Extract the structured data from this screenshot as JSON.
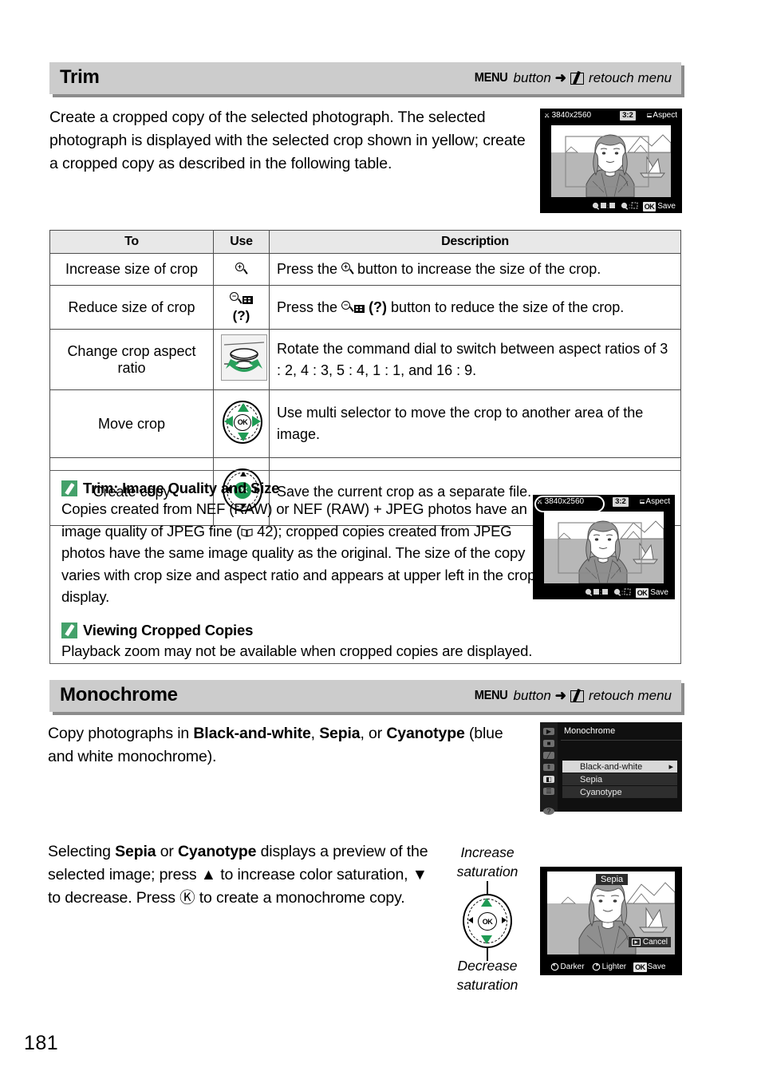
{
  "page": {
    "number": "181"
  },
  "sections": [
    {
      "id": "trim",
      "title": "Trim",
      "path": {
        "menu_word": "MENU",
        "button_word": "button",
        "arrow": "➜",
        "menu_icon": "retouch-menu-icon",
        "target": "retouch menu"
      },
      "intro": "Create a cropped copy of the selected photograph.  The selected photograph is displayed with the selected crop shown in yellow; create a cropped copy as described in the following table."
    },
    {
      "id": "monochrome",
      "title": "Monochrome",
      "path": {
        "menu_word": "MENU",
        "button_word": "button",
        "arrow": "➜",
        "menu_icon": "retouch-menu-icon",
        "target": "retouch menu"
      },
      "intro_parts": {
        "a": "Copy photographs in ",
        "b": "Black-and-white",
        "c": ", ",
        "d": "Sepia",
        "e": ", or ",
        "f": "Cyanotype",
        "g": " (blue and white monochrome)."
      },
      "detail_parts": {
        "a": "Selecting ",
        "b": "Sepia",
        "c": " or ",
        "d": "Cyanotype",
        "e": " displays a preview of the selected image; press ",
        "f": "▲",
        "g": " to increase color saturation, ",
        "h": "▼",
        "i": " to decrease.  Press ",
        "j": "Ⓚ",
        "k": " to create a monochrome copy."
      }
    }
  ],
  "table": {
    "headers": [
      "To",
      "Use",
      "Description"
    ],
    "rows": [
      {
        "to": "Increase size of crop",
        "use_icon": "zoom-in-icon",
        "use_text": "",
        "desc_before": "Press the ",
        "desc_after": " button to increase the size of the crop."
      },
      {
        "to": "Reduce size of crop",
        "use_icon": "zoom-out-thumbnail-help-icon",
        "use_text": "(?)",
        "desc_before": "Press the ",
        "desc_after": " button to reduce the size of the crop."
      },
      {
        "to": "Change crop aspect ratio",
        "use_icon": "command-dial-icon",
        "use_text": "",
        "desc_before": "Rotate the command dial to switch between aspect ratios of 3 : 2, 4 : 3, 5 : 4, 1 : 1, and 16 : 9.",
        "desc_after": ""
      },
      {
        "to": "Move crop",
        "use_icon": "multi-selector-icon",
        "use_text": "",
        "desc_before": "Use multi selector to move the crop to another area of the image.",
        "desc_after": ""
      },
      {
        "to": "Create copy",
        "use_icon": "ok-button-icon",
        "use_text": "",
        "desc_before": "Save the current crop as a separate file.",
        "desc_after": ""
      }
    ]
  },
  "notes": [
    {
      "icon": "pencil-note-icon",
      "heading": "Trim: Image Quality and Size",
      "body_a": "Copies created from NEF (RAW) or NEF (RAW) + JPEG photos have an image quality of JPEG fine (",
      "body_ref_icon": "book-reference-icon",
      "body_ref": " 42",
      "body_b": "); cropped copies created from JPEG photos have the same image quality as the original.  The size of the copy varies with crop size and aspect ratio and appears at upper left in the crop display."
    },
    {
      "icon": "pencil-note-icon",
      "heading": "Viewing Cropped Copies",
      "body_a": "Playback zoom may not be available when cropped copies are displayed.",
      "body_ref_icon": "",
      "body_ref": "",
      "body_b": ""
    }
  ],
  "lcd_trim": {
    "scissors_icon": "scissors-icon",
    "size": "3840x2560",
    "ratio": "3:2",
    "aspect_icon": "aspect-icon",
    "aspect_label": "Aspect",
    "hint_zoom_out_icon": "zoom-out-thumbnail-icon",
    "hint_thumb_icon": "thumbnail-grid-icon",
    "hint_zoom_in_icon": "zoom-in-icon",
    "hint_crop_icon": "crop-frame-icon",
    "ok_badge": "OK",
    "ok_label": "Save"
  },
  "lcd_trim_note": {
    "scissors_icon": "scissors-icon",
    "size": "3840x2560",
    "ratio": "3:2",
    "aspect_icon": "aspect-icon",
    "aspect_label": "Aspect",
    "ok_badge": "OK",
    "ok_label": "Save",
    "highlight": "size-highlight-oval"
  },
  "lcd_menu": {
    "title": "Monochrome",
    "rail": [
      {
        "name": "playback-menu-icon",
        "glyph": "▶",
        "selected": false
      },
      {
        "name": "shooting-menu-icon",
        "glyph": "■",
        "selected": false
      },
      {
        "name": "custom-settings-menu-icon",
        "glyph": "╱",
        "selected": false
      },
      {
        "name": "setup-menu-icon",
        "glyph": "⑂",
        "selected": false
      },
      {
        "name": "retouch-menu-icon",
        "glyph": "◧",
        "selected": true
      },
      {
        "name": "recent-settings-menu-icon",
        "glyph": "☰",
        "selected": false
      },
      {
        "name": "help-icon",
        "glyph": "?",
        "selected": false
      }
    ],
    "items": [
      {
        "label": "Black-and-white",
        "selected": true,
        "chevron": "▸"
      },
      {
        "label": "Sepia",
        "selected": false,
        "chevron": ""
      },
      {
        "label": "Cyanotype",
        "selected": false,
        "chevron": ""
      }
    ]
  },
  "lcd_sepia": {
    "mode_label": "Sepia",
    "cancel_icon": "playback-button-icon",
    "cancel_label": "Cancel",
    "darker_icon": "dial-down-icon",
    "darker_label": "Darker",
    "lighter_icon": "dial-up-icon",
    "lighter_label": "Lighter",
    "ok_badge": "OK",
    "ok_label": "Save"
  },
  "callouts": {
    "increase": "Increase\nsaturation",
    "increase_l1": "Increase",
    "increase_l2": "saturation",
    "decrease_l1": "Decrease",
    "decrease_l2": "saturation"
  },
  "colors": {
    "header_bar": "#cccccc",
    "header_shadow": "#8c8c8c",
    "accent_green": "#1f9a54",
    "note_green": "#44a16a",
    "table_header": "#e8e8e8",
    "rule": "#4d4d4d"
  }
}
